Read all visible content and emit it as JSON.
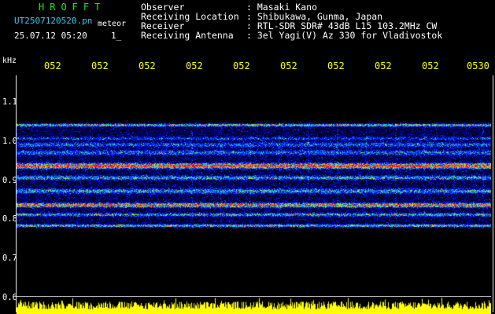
{
  "header": {
    "app_title": "HROFFT",
    "file_name": "UT2507120520.pn",
    "file_suffix": "meteor",
    "datetime": "25.07.12 05:20",
    "marker": "1_"
  },
  "info": [
    {
      "label": "Observer",
      "value": ": Masaki Kano"
    },
    {
      "label": "Receiving Location",
      "value": ": Shibukawa, Gunma, Japan"
    },
    {
      "label": "Receiver",
      "value": ": RTL-SDR SDR# 43dB L15 103.2MHz CW"
    },
    {
      "label": "Receiving Antenna",
      "value": ": 3el Yagi(V) Az 330 for Vladivostok"
    }
  ],
  "axis": {
    "unit": "kHz",
    "time_ticks": [
      "052",
      "052",
      "052",
      "052",
      "052",
      "052",
      "052",
      "052",
      "052",
      "0530"
    ],
    "freq_ticks": [
      "1.1",
      "1.0",
      "0.9",
      "0.8",
      "0.7",
      "0.6"
    ],
    "freq_range_khz": [
      0.6,
      1.15
    ]
  },
  "colors": {
    "background": "#000000",
    "title": "#20e020",
    "filename": "#30d0f0",
    "time_ticks": "#ffff00",
    "text": "#ffffff",
    "amplitude": "#ffff00"
  }
}
